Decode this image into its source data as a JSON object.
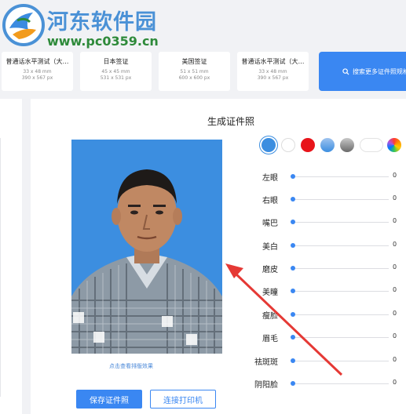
{
  "watermark": {
    "site_name": "河东软件园",
    "url": "www.pc0359.cn"
  },
  "spec_cards": [
    {
      "name": "普通话水平测试（大…",
      "size": "33 x 48 mm",
      "px": "390 x 567 px"
    },
    {
      "name": "日本签证",
      "size": "45 x 45 mm",
      "px": "531 x 531 px"
    },
    {
      "name": "美国签证",
      "size": "51 x 51 mm",
      "px": "600 x 600 px"
    },
    {
      "name": "普通话水平测试（大…",
      "size": "33 x 48 mm",
      "px": "390 x 567 px"
    }
  ],
  "search_button": {
    "label": "搜索更多证件照规格",
    "icon": "search-icon"
  },
  "main": {
    "title": "生成证件照",
    "hint": "点击查看排版效果",
    "save_button": "保存证件照",
    "print_button": "连接打印机"
  },
  "background_colors": [
    {
      "name": "blue",
      "color": "#3c8ee0",
      "selected": true
    },
    {
      "name": "white",
      "color": "#ffffff"
    },
    {
      "name": "red",
      "color": "#e8141a"
    },
    {
      "name": "blue-gradient",
      "color": "#5b9ce6"
    },
    {
      "name": "gray-gradient",
      "color": "#8a8a8a"
    },
    {
      "name": "white-gradient",
      "color": "#ffffff"
    },
    {
      "name": "rainbow",
      "color": "#ff7f2a"
    }
  ],
  "adjustments": [
    {
      "label": "左眼",
      "value": "0",
      "level": 0
    },
    {
      "label": "右眼",
      "value": "0",
      "level": 0
    },
    {
      "label": "嘴巴",
      "value": "0",
      "level": 0
    },
    {
      "label": "美白",
      "value": "0",
      "level": 0
    },
    {
      "label": "磨皮",
      "value": "0",
      "level": 0
    },
    {
      "label": "美瞳",
      "value": "0",
      "level": 0
    },
    {
      "label": "瘦脸",
      "value": "0",
      "level": 0
    },
    {
      "label": "眉毛",
      "value": "0",
      "level": 0
    },
    {
      "label": "祛斑斑",
      "value": "0",
      "level": 0
    },
    {
      "label": "阴阳脸",
      "value": "0",
      "level": 0
    }
  ],
  "colors": {
    "accent": "#3a87f2",
    "annotation_arrow": "#e53935"
  }
}
